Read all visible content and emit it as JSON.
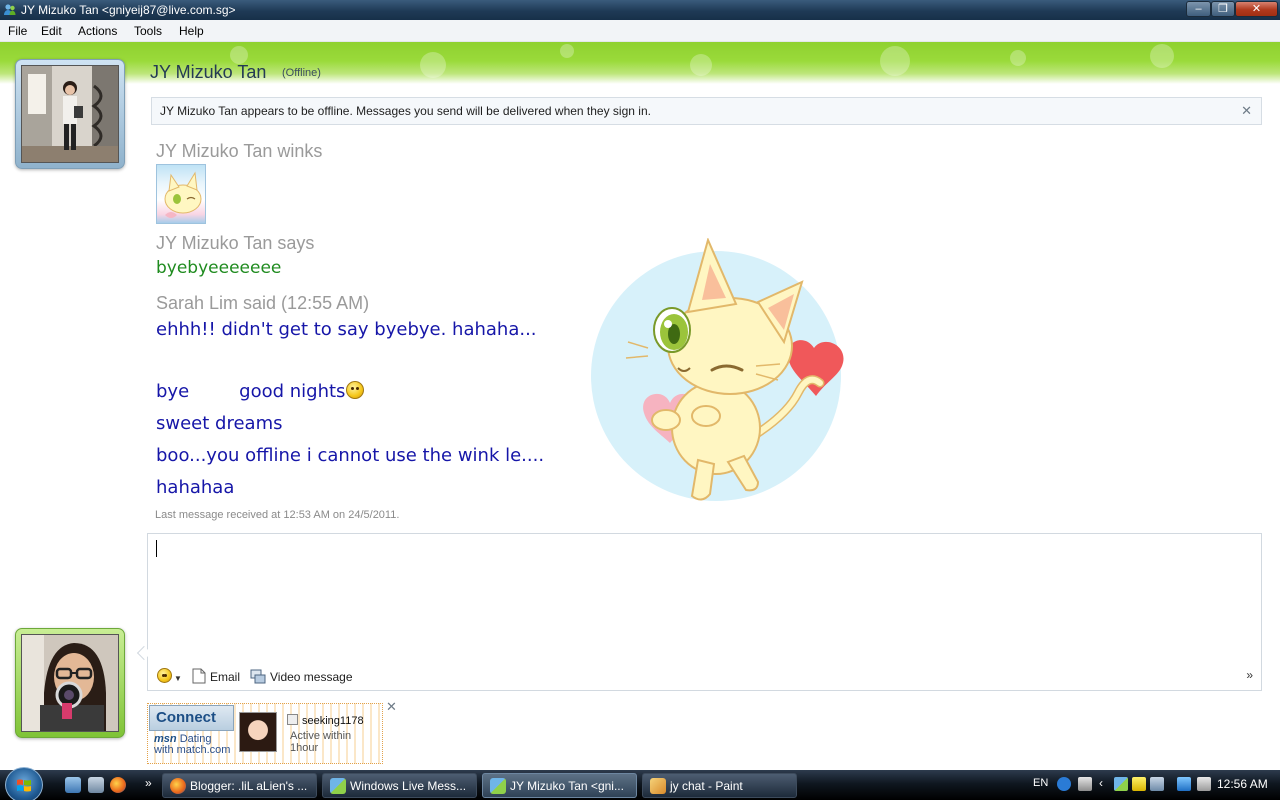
{
  "window": {
    "title": "JY Mizuko Tan <gniyeij87@live.com.sg>",
    "min_glyph": "–",
    "max_glyph": "❐",
    "close_glyph": "✕"
  },
  "menu": [
    "File",
    "Edit",
    "Actions",
    "Tools",
    "Help"
  ],
  "header": {
    "contact_name": "JY Mizuko Tan",
    "status": "(Offline)"
  },
  "notice": {
    "text": "JY Mizuko Tan appears to be offline. Messages you send will be delivered when they sign in.",
    "close_glyph": "✕"
  },
  "conversation": {
    "wink_header": "JY Mizuko Tan winks",
    "contact_says": "JY Mizuko Tan says",
    "contact_message": "byebyeeeeeee",
    "self_header": "Sarah Lim said (12:55 AM)",
    "self_lines": {
      "line1": "ehhh!! didn't get to say byebye. hahaha...",
      "line2a": "bye",
      "line2b": "good nights",
      "line3": "sweet dreams",
      "line4": "boo...you offline i cannot use the wink le....",
      "line5": "hahahaa"
    },
    "last_received": "Last message received at 12:53 AM on 24/5/2011."
  },
  "compose": {
    "email_label": "Email",
    "video_label": "Video message",
    "more_glyph": "»"
  },
  "ad": {
    "connect": "Connect",
    "brand_line1": "msn",
    "brand_line1b": "Dating",
    "brand_line2": "with match.com",
    "username": "seeking1178",
    "active": "Active within 1hour",
    "close_glyph": "✕"
  },
  "taskbar": {
    "quick_more": "»",
    "tasks": [
      "Blogger: .liL aLien's ...",
      "Windows Live Mess...",
      "JY Mizuko Tan <gni...",
      "jy chat - Paint"
    ],
    "lang": "EN",
    "clock": "12:56 AM",
    "tray_arrow": "‹"
  },
  "colors": {
    "banner_green": "#9ada3a",
    "contact_msg_green": "#1f8b1f",
    "self_msg_blue": "#1616a8",
    "sender_gray": "#9a9a9a"
  }
}
